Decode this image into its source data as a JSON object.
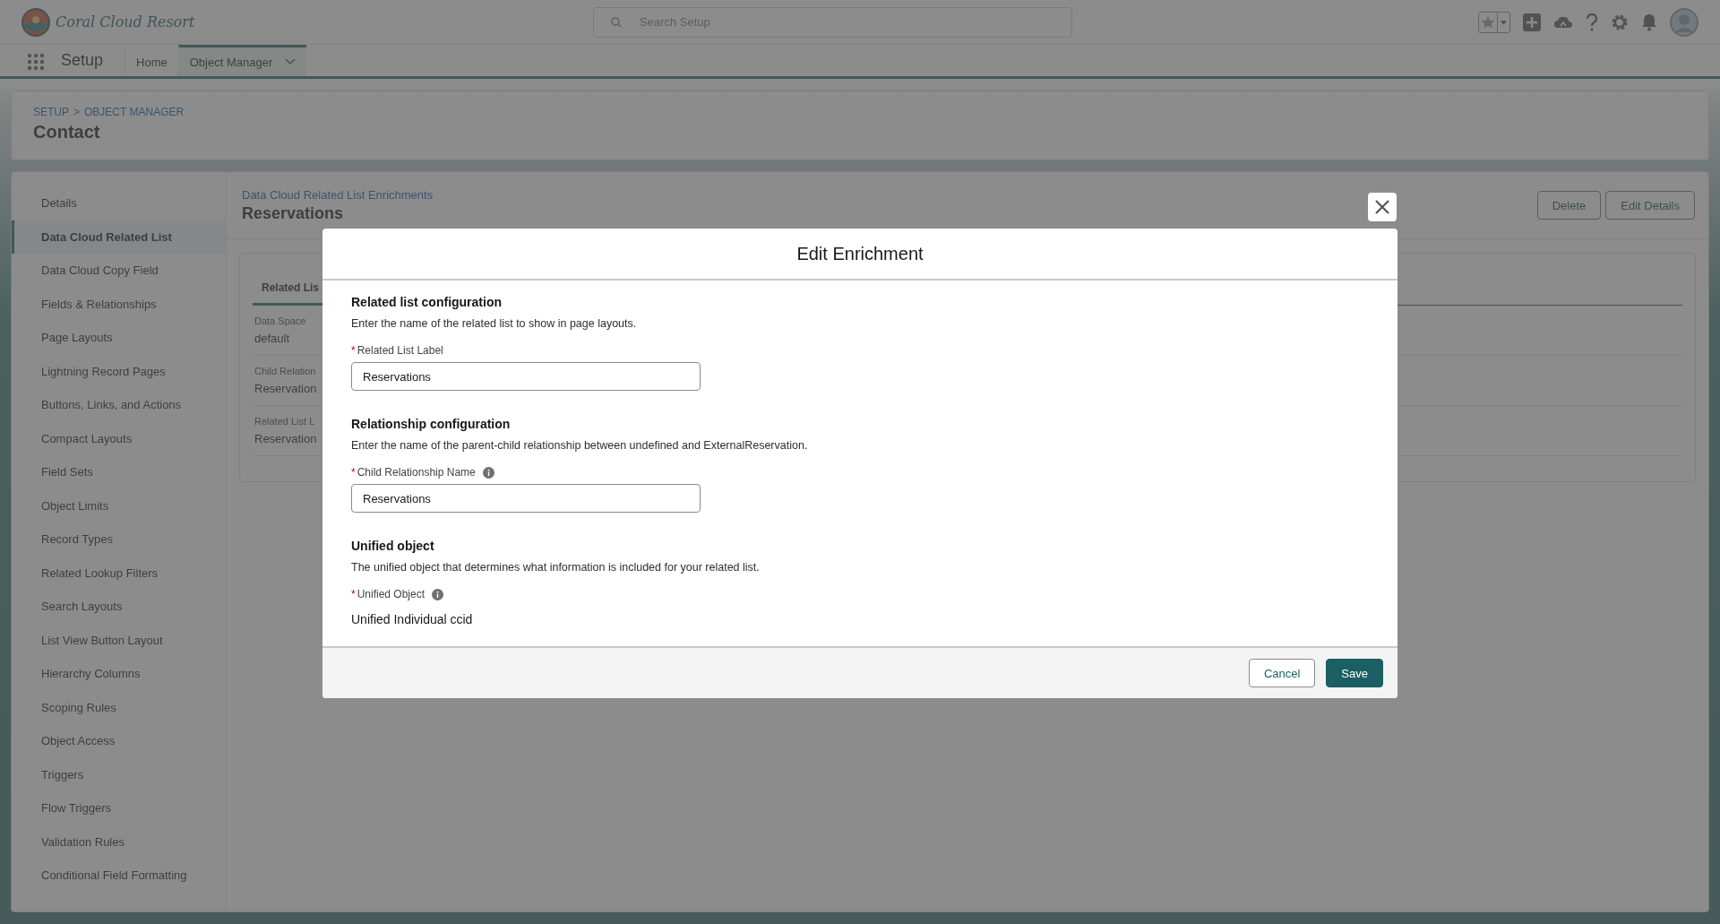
{
  "header": {
    "brand": "Coral Cloud Resort",
    "search": {
      "placeholder": "Search Setup"
    }
  },
  "nav": {
    "app": "Setup",
    "tabs": [
      {
        "label": "Home",
        "selected": false,
        "has_menu": false
      },
      {
        "label": "Object Manager",
        "selected": true,
        "has_menu": true
      }
    ]
  },
  "page_header": {
    "breadcrumbs": [
      "SETUP",
      "OBJECT MANAGER"
    ],
    "separator": ">",
    "title": "Contact"
  },
  "sidebar": {
    "items": [
      {
        "label": "Details",
        "selected": false
      },
      {
        "label": "Data Cloud Related List",
        "selected": true
      },
      {
        "label": "Data Cloud Copy Field",
        "selected": false
      },
      {
        "label": "Fields & Relationships",
        "selected": false
      },
      {
        "label": "Page Layouts",
        "selected": false
      },
      {
        "label": "Lightning Record Pages",
        "selected": false
      },
      {
        "label": "Buttons, Links, and Actions",
        "selected": false
      },
      {
        "label": "Compact Layouts",
        "selected": false
      },
      {
        "label": "Field Sets",
        "selected": false
      },
      {
        "label": "Object Limits",
        "selected": false
      },
      {
        "label": "Record Types",
        "selected": false
      },
      {
        "label": "Related Lookup Filters",
        "selected": false
      },
      {
        "label": "Search Layouts",
        "selected": false
      },
      {
        "label": "List View Button Layout",
        "selected": false
      },
      {
        "label": "Hierarchy Columns",
        "selected": false
      },
      {
        "label": "Scoping Rules",
        "selected": false
      },
      {
        "label": "Object Access",
        "selected": false
      },
      {
        "label": "Triggers",
        "selected": false
      },
      {
        "label": "Flow Triggers",
        "selected": false
      },
      {
        "label": "Validation Rules",
        "selected": false
      },
      {
        "label": "Conditional Field Formatting",
        "selected": false
      }
    ]
  },
  "record": {
    "eyebrow": "Data Cloud Related List Enrichments",
    "title": "Reservations",
    "buttons": [
      "Delete",
      "Edit Details"
    ],
    "tabs": [
      {
        "label": "Related Lis",
        "selected": true
      }
    ],
    "fields": [
      {
        "label": "Data Space",
        "value": "default"
      },
      {
        "label": "Child Relation",
        "value": "Reservation"
      },
      {
        "label": "Related List L",
        "value": "Reservation"
      }
    ]
  },
  "modal": {
    "title": "Edit Enrichment",
    "required_mark": "*",
    "sections": [
      {
        "heading": "Related list configuration",
        "description": "Enter the name of the related list to show in page layouts.",
        "field": {
          "label": "Related List Label",
          "required": true,
          "info": false,
          "kind": "input",
          "value": "Reservations"
        }
      },
      {
        "heading": "Relationship configuration",
        "description": "Enter the name of the parent-child relationship between undefined and ExternalReservation.",
        "field": {
          "label": "Child Relationship Name",
          "required": true,
          "info": true,
          "kind": "input",
          "value": "Reservations"
        }
      },
      {
        "heading": "Unified object",
        "description": "The unified object that determines what information is included for your related list.",
        "field": {
          "label": "Unified Object",
          "required": true,
          "info": true,
          "kind": "readonly",
          "value": "Unified Individual ccid"
        }
      }
    ],
    "buttons": [
      {
        "label": "Cancel",
        "kind": "neutral"
      },
      {
        "label": "Save",
        "kind": "brand"
      }
    ]
  }
}
